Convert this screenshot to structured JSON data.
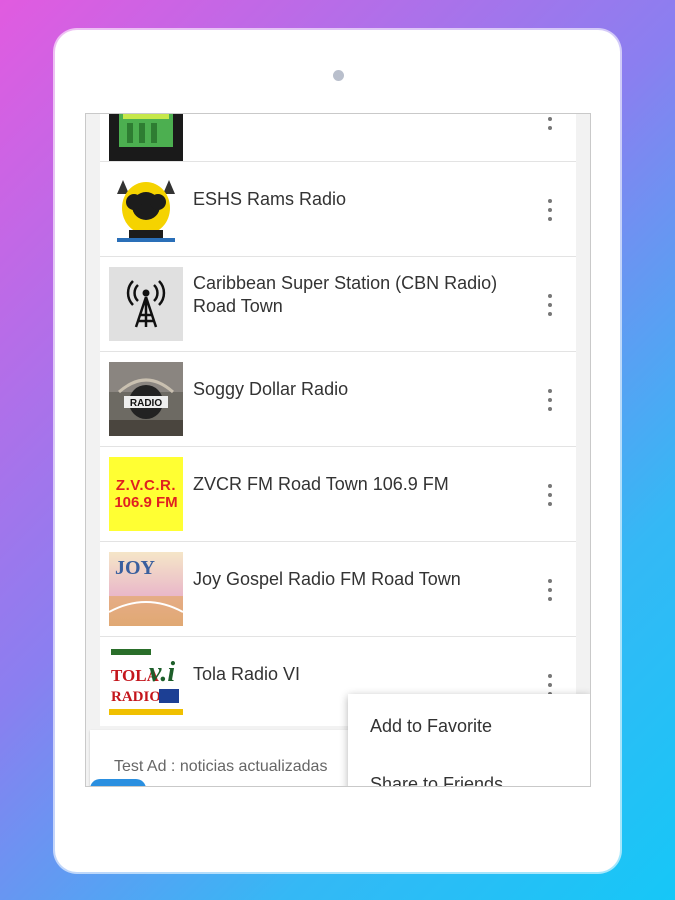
{
  "stations": [
    {
      "name": "",
      "thumb": "green-antenna-logo"
    },
    {
      "name": "ESHS Rams Radio",
      "thumb": "rams-logo"
    },
    {
      "name": "Caribbean Super Station (CBN Radio) Road Town",
      "thumb": "broadcast-tower-icon"
    },
    {
      "name": "Soggy Dollar Radio",
      "thumb": "radio-badge-logo"
    },
    {
      "name": "ZVCR FM Road Town 106.9 FM",
      "thumb": "zvcr-logo",
      "logo_line1": "Z.V.C.R.",
      "logo_line2": "106.9 FM"
    },
    {
      "name": "Joy Gospel Radio FM Road Town",
      "thumb": "joy-logo",
      "logo_text": "JOY"
    },
    {
      "name": "Tola Radio VI",
      "thumb": "tola-logo",
      "logo_text": "TOLA",
      "logo_text2": "RADIO",
      "logo_vi": "v.i"
    }
  ],
  "ad": {
    "text": "Test Ad : noticias actualizadas"
  },
  "context_menu": {
    "items": [
      "Add to Favorite",
      "Share to Friends"
    ]
  },
  "colors": {
    "zvcr_bg": "#ffff33",
    "zvcr_text": "#e02020"
  }
}
